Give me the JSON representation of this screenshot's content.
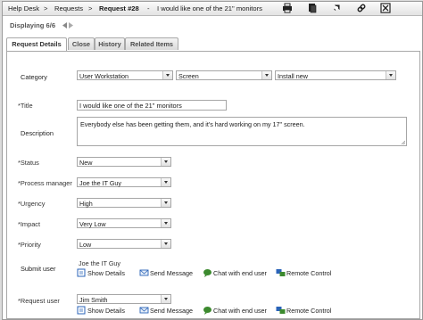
{
  "breadcrumb": {
    "help_desk": "Help Desk",
    "requests": "Requests",
    "request_id": "Request #28",
    "dash": "-",
    "request_title": "I would like one of the 21\" monitors",
    "separator": ">"
  },
  "toolbar": {
    "icons": [
      "print-icon",
      "copy-icon",
      "recycle-icon",
      "link-icon",
      "close-icon"
    ]
  },
  "displaying": "Displaying 6/6",
  "tabs": [
    "Request Details",
    "Close",
    "History",
    "Related Items"
  ],
  "form": {
    "category": {
      "label": "Category",
      "values": [
        "User Workstation",
        "Screen",
        "Install new"
      ]
    },
    "title": {
      "label": "*Title",
      "value": "I would like one of the 21\" monitors"
    },
    "description": {
      "label": "Description",
      "value": "Everybody else has been getting them, and it's hard working on my 17\" screen."
    },
    "status": {
      "label": "*Status",
      "value": "New"
    },
    "process_manager": {
      "label": "*Process manager",
      "value": "Joe the IT Guy"
    },
    "urgency": {
      "label": "*Urgency",
      "value": "High"
    },
    "impact": {
      "label": "*Impact",
      "value": "Very Low"
    },
    "priority": {
      "label": "*Priority",
      "value": "Low"
    },
    "submit_user": {
      "label": "Submit user",
      "name": "Joe the IT Guy"
    },
    "request_user": {
      "label": "*Request user",
      "value": "Jim Smith"
    }
  },
  "actions": {
    "show_details": "Show Details",
    "send_message": "Send Message",
    "chat": "Chat with end user",
    "remote_control": "Remote Control"
  },
  "colors": {
    "accent_green": "#3c8a2e",
    "link_blue": "#2a63b8"
  }
}
